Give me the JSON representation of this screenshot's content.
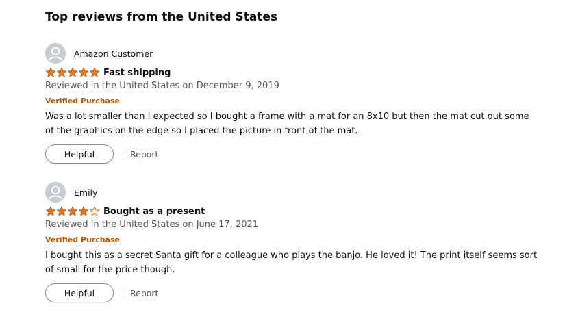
{
  "section": {
    "heading": "Top reviews from the United States"
  },
  "colors": {
    "star_fill": "#de7921",
    "verified": "#c45500",
    "secondary_text": "#565959"
  },
  "reviews": [
    {
      "author": "Amazon Customer",
      "rating": 5,
      "rating_max": 5,
      "title": "Fast shipping",
      "date": "Reviewed in the United States on December 9, 2019",
      "verified": "Verified Purchase",
      "body": "Was a lot smaller than I expected so I bought a frame with a mat for an 8x10 but then the mat cut out some of the graphics on the edge so I placed the picture in front of the mat.",
      "helpful_label": "Helpful",
      "report_label": "Report"
    },
    {
      "author": "Emily",
      "rating": 4,
      "rating_max": 5,
      "title": "Bought as a present",
      "date": "Reviewed in the United States on June 17, 2021",
      "verified": "Verified Purchase",
      "body": "I bought this as a secret Santa gift for a colleague who plays the banjo. He loved it! The print itself seems sort of small for the price though.",
      "helpful_label": "Helpful",
      "report_label": "Report"
    }
  ]
}
